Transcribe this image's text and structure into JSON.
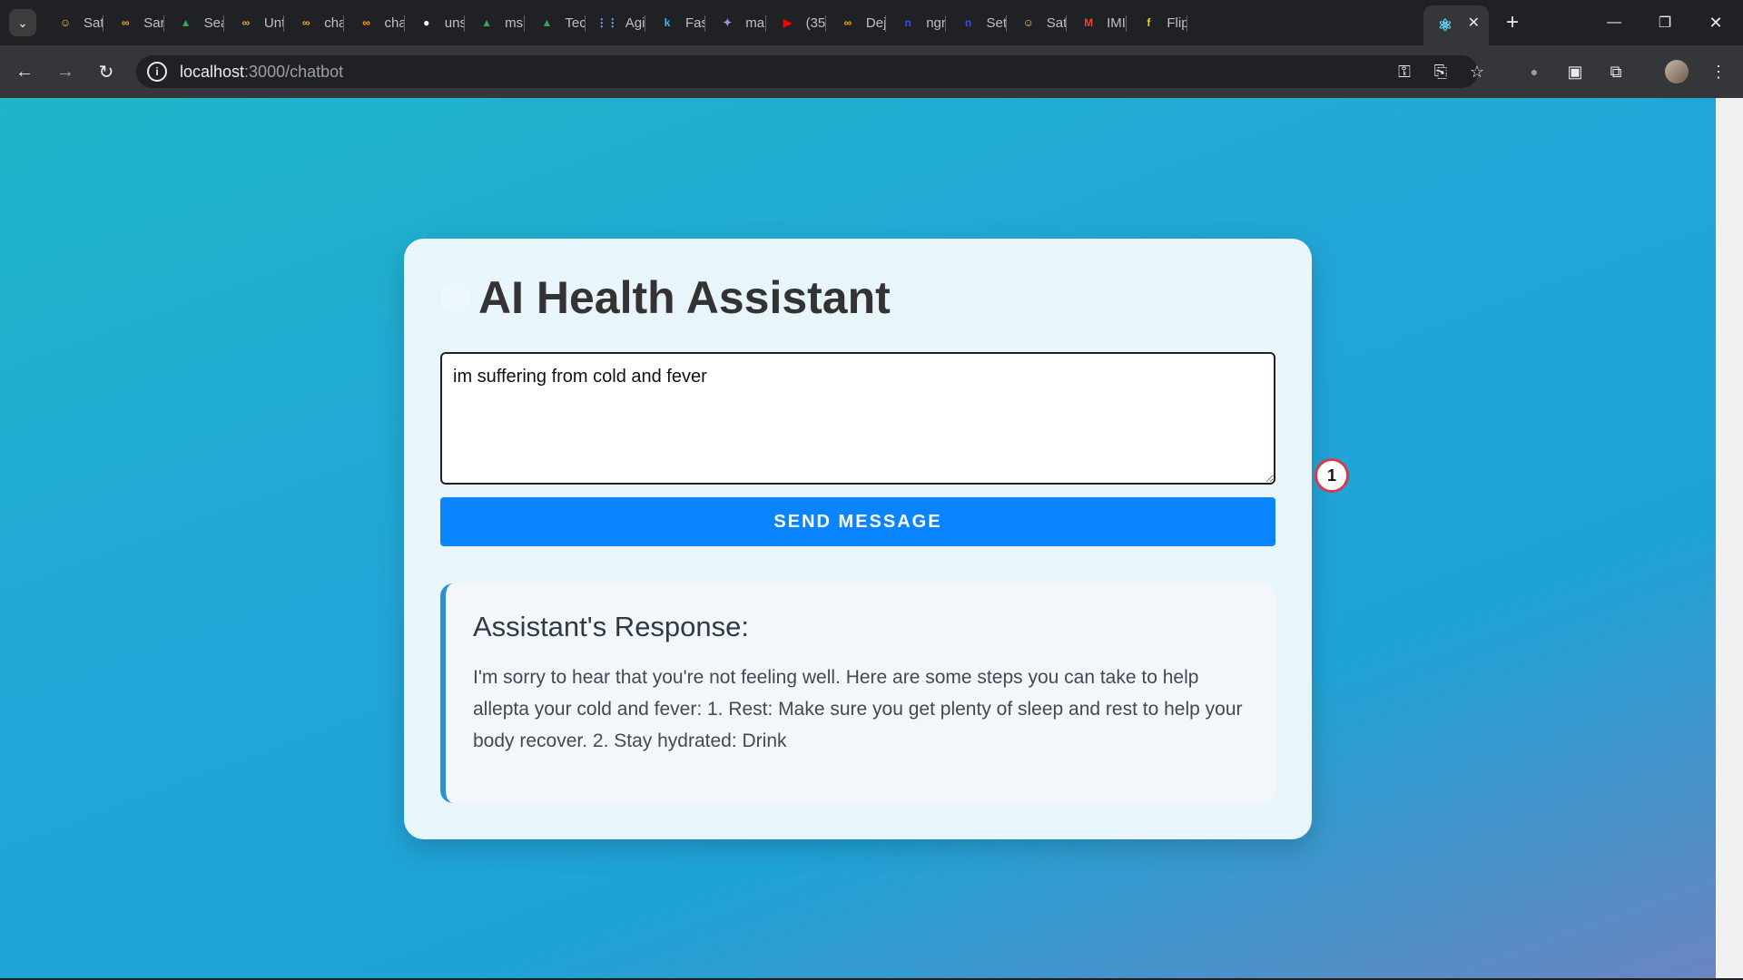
{
  "browser": {
    "tabs": [
      {
        "label": "Sat",
        "icon": "hugging-face-icon",
        "color": "#f6c344",
        "glyph": "☺"
      },
      {
        "label": "Sar",
        "icon": "infinity-icon",
        "color": "#f5a623",
        "glyph": "∞"
      },
      {
        "label": "Sea",
        "icon": "google-drive-icon",
        "color": "#34a853",
        "glyph": "▲"
      },
      {
        "label": "Unt",
        "icon": "infinity-icon",
        "color": "#f5a623",
        "glyph": "∞"
      },
      {
        "label": "cha",
        "icon": "infinity-icon",
        "color": "#f5a623",
        "glyph": "∞"
      },
      {
        "label": "cha",
        "icon": "infinity-icon",
        "color": "#f5a623",
        "glyph": "∞"
      },
      {
        "label": "uns",
        "icon": "github-icon",
        "color": "#ffffff",
        "glyph": "●"
      },
      {
        "label": "ms",
        "icon": "google-drive-icon",
        "color": "#34a853",
        "glyph": "▲"
      },
      {
        "label": "Tec",
        "icon": "google-drive-icon",
        "color": "#34a853",
        "glyph": "▲"
      },
      {
        "label": "Agi",
        "icon": "grid-icon",
        "color": "#8ab4f8",
        "glyph": "⋮⋮"
      },
      {
        "label": "Fas",
        "icon": "k-icon",
        "color": "#20beff",
        "glyph": "k"
      },
      {
        "label": "ma",
        "icon": "sparkle-icon",
        "color": "#a78bfa",
        "glyph": "✦"
      },
      {
        "label": "(35",
        "icon": "youtube-icon",
        "color": "#ff0000",
        "glyph": "▶"
      },
      {
        "label": "Dej",
        "icon": "infinity-icon",
        "color": "#f5a623",
        "glyph": "∞"
      },
      {
        "label": "ngr",
        "icon": "n-icon",
        "color": "#3d4fd9",
        "glyph": "n"
      },
      {
        "label": "Set",
        "icon": "n-icon",
        "color": "#3d4fd9",
        "glyph": "n"
      },
      {
        "label": "Sat",
        "icon": "hugging-face-icon",
        "color": "#f6c344",
        "glyph": "☺"
      },
      {
        "label": "IMI",
        "icon": "gmail-icon",
        "color": "#ea4335",
        "glyph": "M"
      },
      {
        "label": "Flip",
        "icon": "flipkart-icon",
        "color": "#f7d417",
        "glyph": "f"
      }
    ],
    "active_tab": {
      "label": "",
      "icon": "react-icon",
      "color": "#61dafb",
      "glyph": "⚛"
    },
    "url_host": "localhost",
    "url_path": ":3000/chatbot"
  },
  "app": {
    "title": "AI Health Assistant",
    "input_value": "im suffering from cold and fever",
    "send_label": "SEND MESSAGE",
    "response_title": "Assistant's Response:",
    "response_text": "I'm sorry to hear that you're not feeling well. Here are some steps you can take to help allepta your cold and fever: 1. Rest: Make sure you get plenty of sleep and rest to help your body recover. 2. Stay hydrated: Drink"
  },
  "overlay": {
    "marker_label": "1"
  },
  "colors": {
    "accent": "#0a84ff",
    "response_border": "#2c8fd1",
    "marker_ring": "#d93a4b"
  }
}
